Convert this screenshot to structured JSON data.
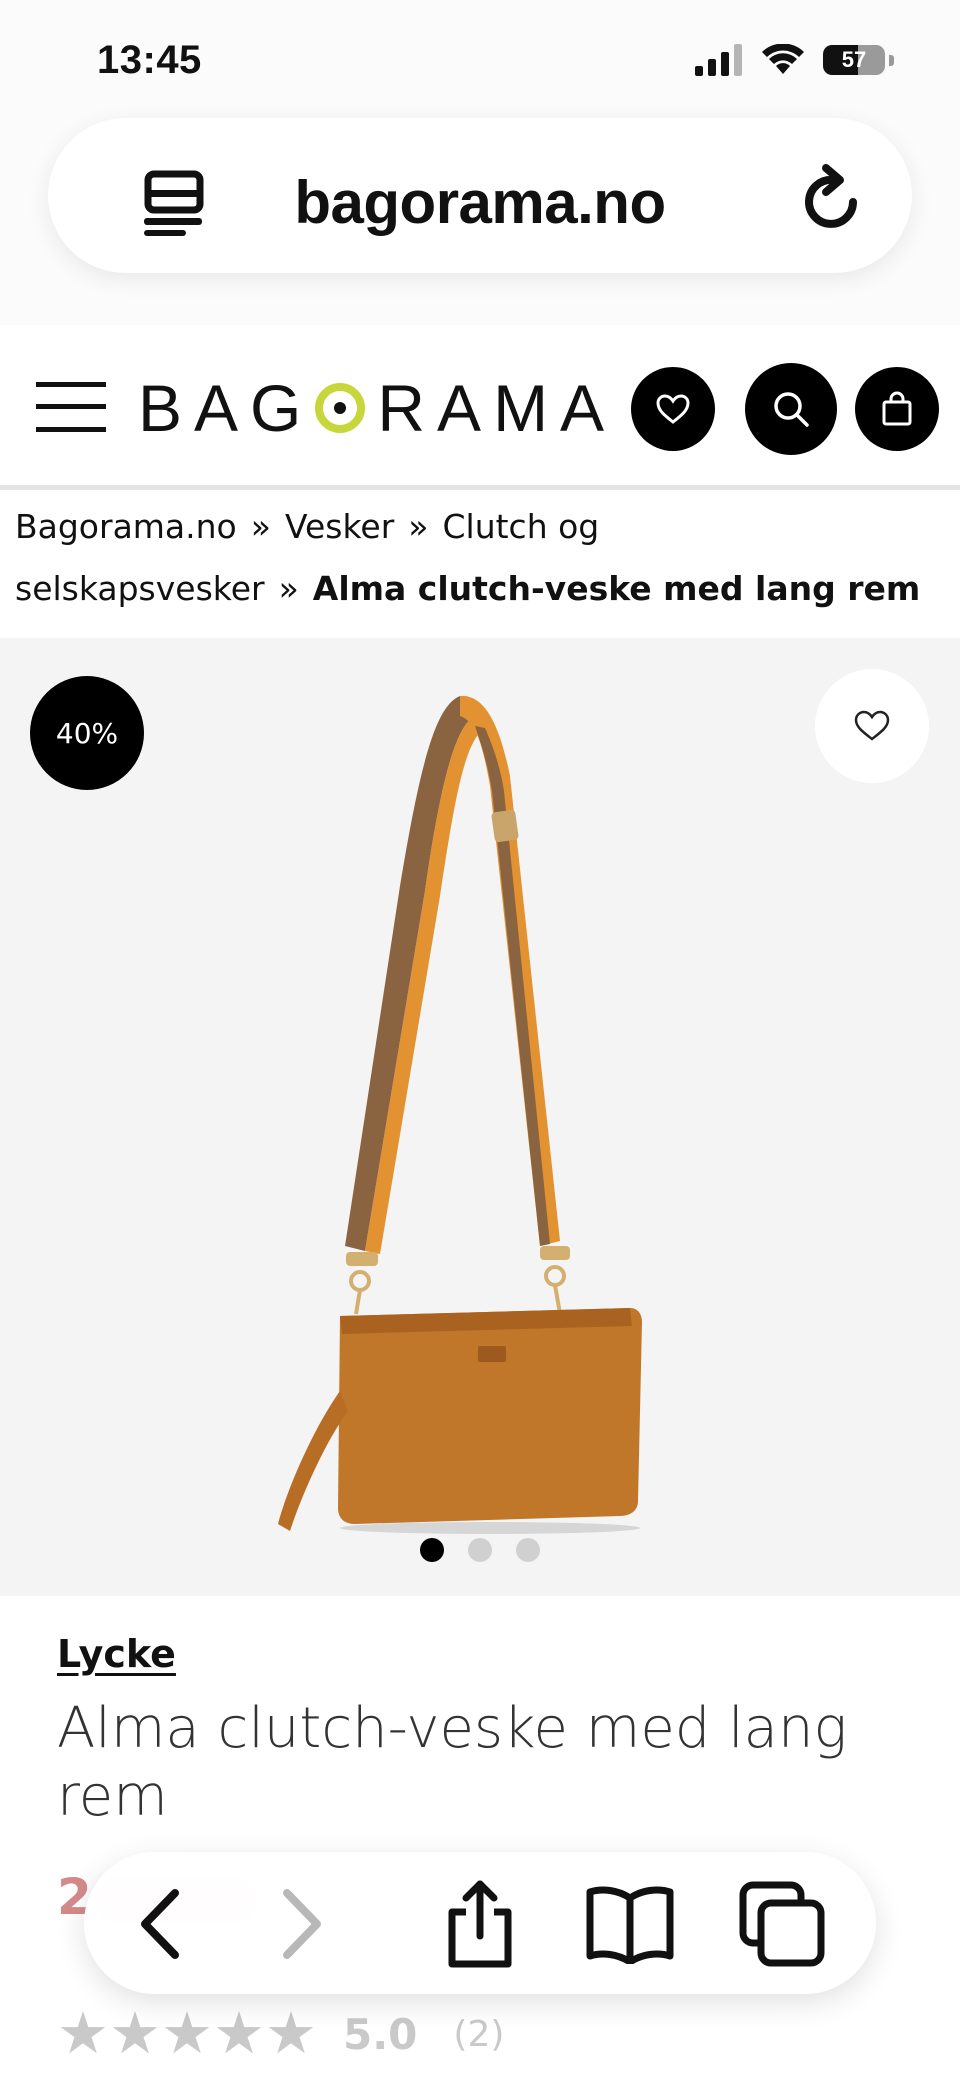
{
  "status_bar": {
    "time": "13:45",
    "battery_level": "57",
    "battery_fraction": 0.57
  },
  "browser": {
    "url": "bagorama.no"
  },
  "site": {
    "logo_pre": "BAG",
    "logo_post": "RAMA"
  },
  "breadcrumb": {
    "items": [
      "Bagorama.no",
      "Vesker",
      "Clutch og selskapsvesker"
    ],
    "separator": "»",
    "current": "Alma clutch-veske med lang rem"
  },
  "product": {
    "discount": "40%",
    "image_count": 3,
    "active_image": 1,
    "brand": "Lycke",
    "title": "Alma clutch-veske med lang rem",
    "price_visible": "2",
    "rating": "5.0",
    "rating_count": "(2)",
    "stars": 5
  },
  "colors": {
    "logo_accent": "#c7d63b",
    "bag": "#c1772a",
    "price": "#d48a8a"
  }
}
